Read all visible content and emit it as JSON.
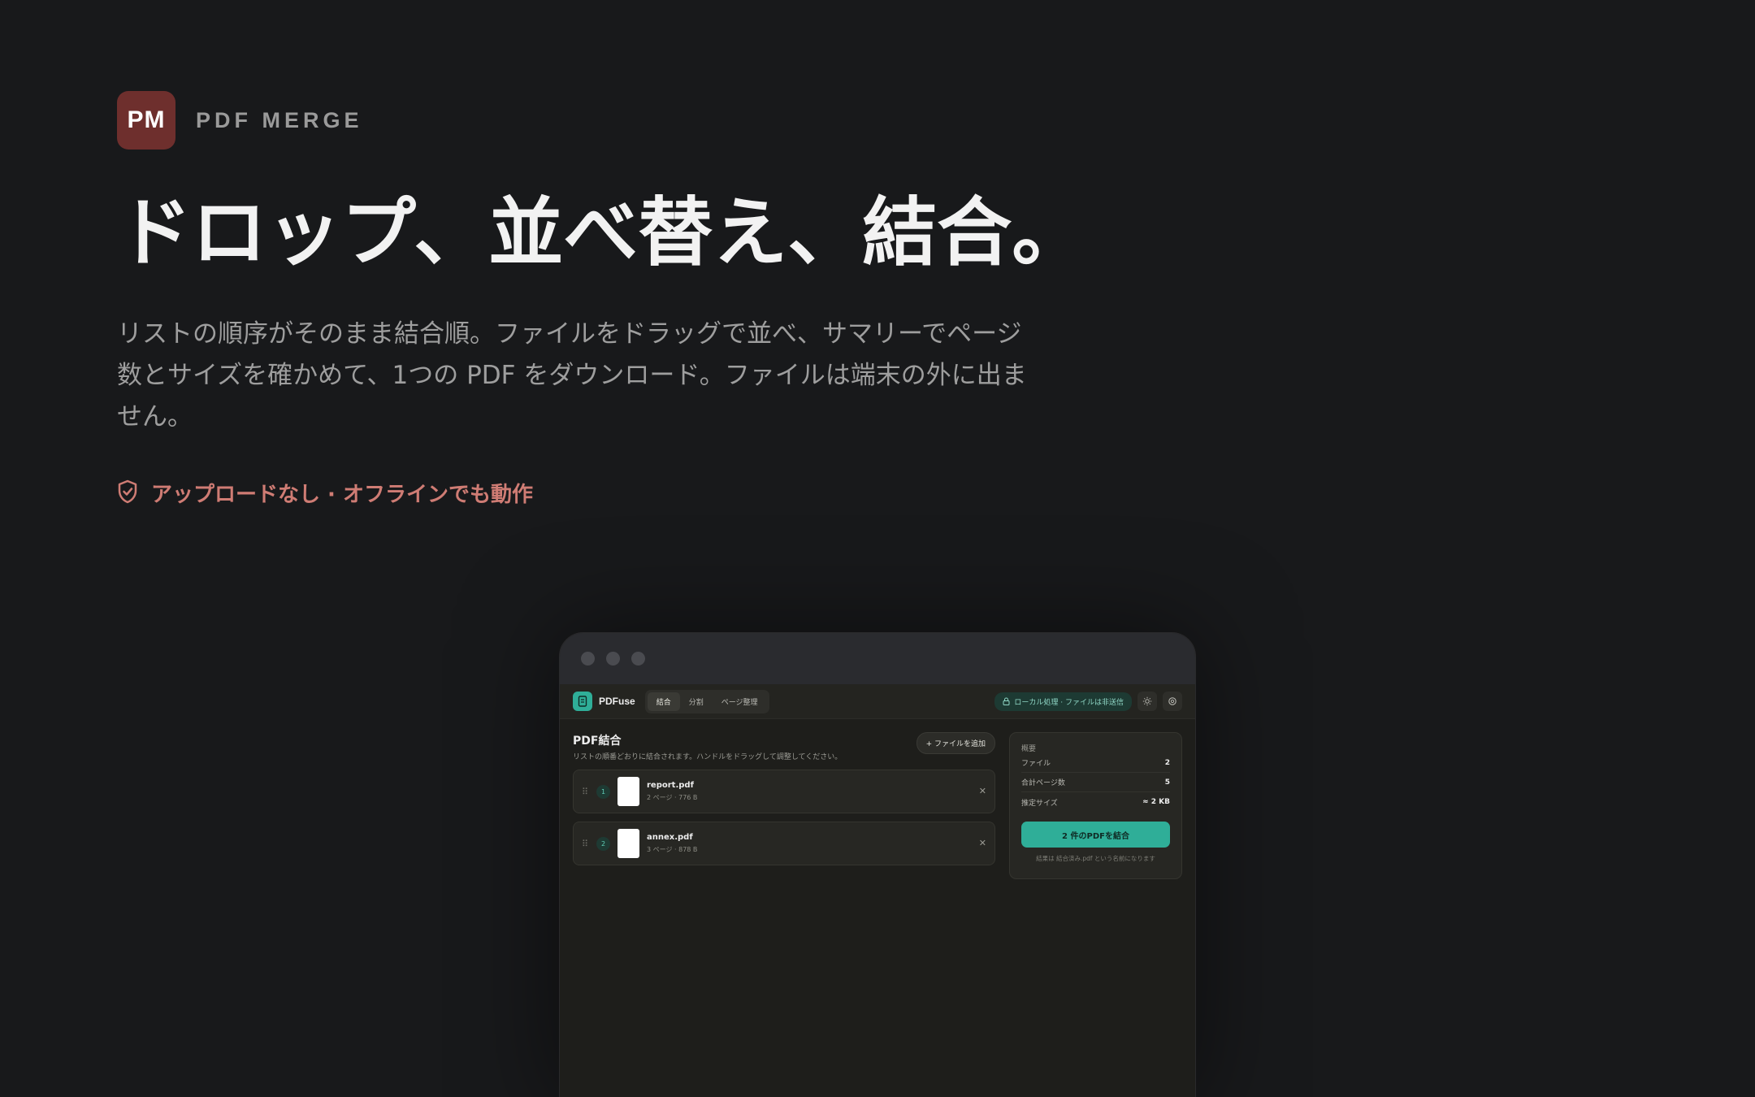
{
  "brand": {
    "badge": "PM",
    "name": "PDF MERGE",
    "badge_color": "#6e2f2d"
  },
  "hero": {
    "headline": "ドロップ、並べ替え、結合。",
    "subtitle": "リストの順序がそのまま結合順。ファイルをドラッグで並べ、サマリーでページ数とサイズを確かめて、1つの PDF をダウンロード。ファイルは端末の外に出ません。",
    "privacy_note": "アップロードなし · オフラインでも動作",
    "accent_color": "#cf7c74"
  },
  "app": {
    "name_prefix": "PDF",
    "name_highlight": "F",
    "name_suffix": "use",
    "tabs": [
      {
        "label": "結合",
        "active": true
      },
      {
        "label": "分割",
        "active": false
      },
      {
        "label": "ページ整理",
        "active": false
      }
    ],
    "local_badge": "ローカル処理 · ファイルは非送信",
    "accent_color": "#2fae98",
    "main": {
      "title": "PDF結合",
      "description": "リストの順番どおりに結合されます。ハンドルをドラッグして調整してください。",
      "add_button": "+ ファイルを追加",
      "files": [
        {
          "index": "1",
          "name": "report.pdf",
          "meta": "2 ページ · 776 B"
        },
        {
          "index": "2",
          "name": "annex.pdf",
          "meta": "3 ページ · 878 B"
        }
      ]
    },
    "summary": {
      "title": "概要",
      "rows": [
        {
          "label": "ファイル",
          "value": "2"
        },
        {
          "label": "合計ページ数",
          "value": "5"
        },
        {
          "label": "推定サイズ",
          "value": "≈ 2 KB"
        }
      ],
      "merge_button": "2 件のPDFを結合",
      "note": "結果は 結合済み.pdf という名前になります"
    }
  }
}
